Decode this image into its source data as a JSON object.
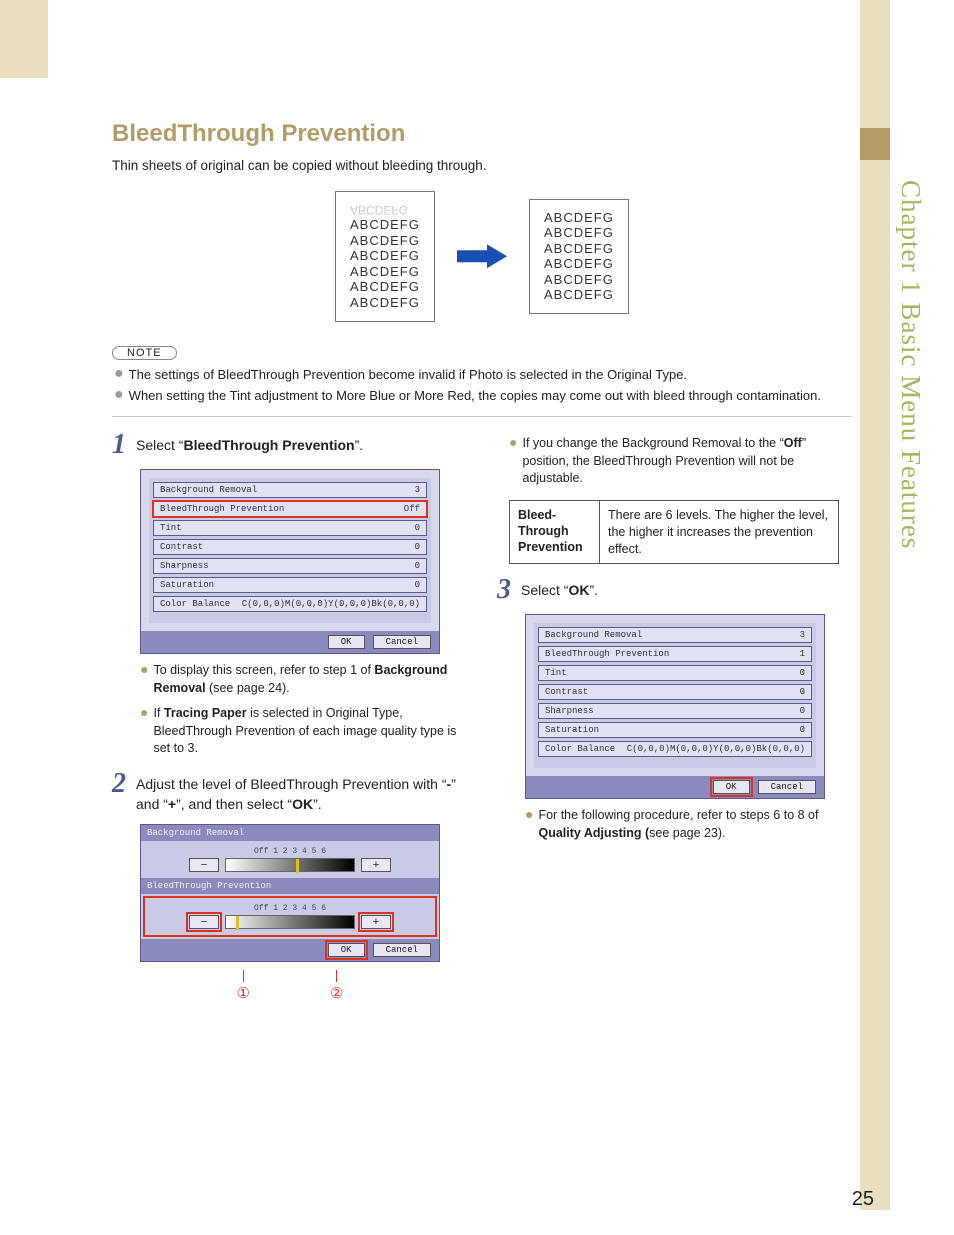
{
  "side_label": "Chapter 1   Basic Menu Features",
  "title": "BleedThrough Prevention",
  "intro": "Thin sheets of original can be copied without bleeding through.",
  "illus_ghost": "ABCDEFG",
  "illus_line": "ABCDEFG",
  "note_label": "NOTE",
  "notes": [
    "The settings of BleedThrough Prevention become invalid if Photo is selected in the Original Type.",
    "When setting the Tint adjustment to More Blue or More Red, the copies may come out with bleed through contamination."
  ],
  "step1": {
    "num": "1",
    "prefix": "Select “",
    "bold": "BleedThrough Prevention",
    "suffix": "”."
  },
  "panel1": {
    "rows": [
      {
        "l": "Background Removal",
        "r": "3"
      },
      {
        "l": "BleedThrough Prevention",
        "r": "Off"
      },
      {
        "l": "Tint",
        "r": "0"
      },
      {
        "l": "Contrast",
        "r": "0"
      },
      {
        "l": "Sharpness",
        "r": "0"
      },
      {
        "l": "Saturation",
        "r": "0"
      },
      {
        "l": "Color Balance",
        "r": "C(0,0,0)M(0,0,0)Y(0,0,0)Bk(0,0,0)"
      }
    ],
    "ok": "OK",
    "cancel": "Cancel"
  },
  "step1_subs": [
    {
      "pre": "To display this screen, refer to step 1 of ",
      "b": "Background Removal",
      "post": " (see page 24)."
    },
    {
      "pre": "If ",
      "b": "Tracing Paper",
      "post": " is selected in Original Type, BleedThrough Prevention of each image quality type is set to 3."
    }
  ],
  "step2": {
    "num": "2",
    "text_pre": "Adjust the level of BleedThrough Prevention with “",
    "m1": "-",
    "text_mid": "” and “",
    "m2": "+",
    "text_mid2": "”, and then select “",
    "ok": "OK",
    "text_post": "”."
  },
  "panel2": {
    "sec1": "Background Removal",
    "scale1": "Off 1  2  3  4  5  6",
    "sec2": "BleedThrough Prevention",
    "scale2": "Off 1  2  3  4  5  6",
    "minus": "−",
    "plus": "+",
    "ok": "OK",
    "cancel": "Cancel"
  },
  "callout1": "①",
  "callout2": "②",
  "right_bullet": {
    "pre": "If you change the Background Removal to the “",
    "b": "Off",
    "post": "” position, the BleedThrough Prevention will not be adjustable."
  },
  "info": {
    "label": "Bleed-\nThrough Prevention",
    "desc": "There are 6 levels. The higher the level, the higher it increases the prevention effect."
  },
  "step3": {
    "num": "3",
    "pre": "Select “",
    "b": "OK",
    "post": "”."
  },
  "panel3": {
    "rows": [
      {
        "l": "Background Removal",
        "r": "3"
      },
      {
        "l": "BleedThrough Prevention",
        "r": "1"
      },
      {
        "l": "Tint",
        "r": "0"
      },
      {
        "l": "Contrast",
        "r": "0"
      },
      {
        "l": "Sharpness",
        "r": "0"
      },
      {
        "l": "Saturation",
        "r": "0"
      },
      {
        "l": "Color Balance",
        "r": "C(0,0,0)M(0,0,0)Y(0,0,0)Bk(0,0,0)"
      }
    ],
    "ok": "OK",
    "cancel": "Cancel"
  },
  "step3_sub": {
    "pre": "For the following procedure, refer to steps 6 to 8 of ",
    "b": "Quality Adjusting (",
    "post": "see page 23)."
  },
  "page_number": "25"
}
